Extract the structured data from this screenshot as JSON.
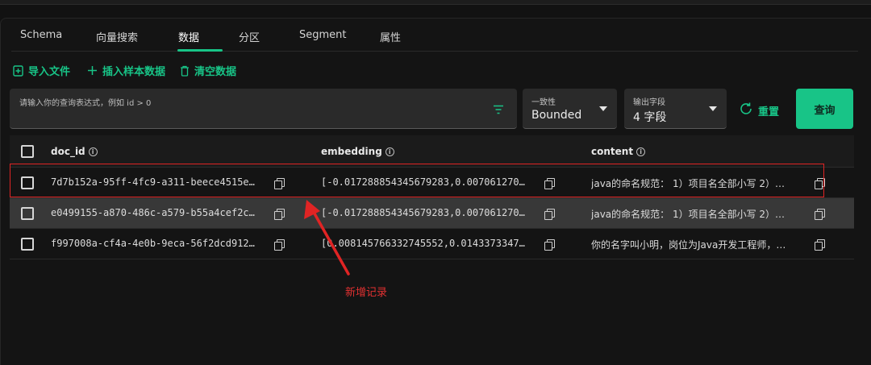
{
  "tabs": [
    {
      "label": "Schema"
    },
    {
      "label": "向量搜索"
    },
    {
      "label": "数据",
      "active": true
    },
    {
      "label": "分区"
    },
    {
      "label": "Segment"
    },
    {
      "label": "属性"
    }
  ],
  "actions": {
    "import": "导入文件",
    "insert_sample": "插入样本数据",
    "clear": "清空数据"
  },
  "query": {
    "placeholder": "请输入你的查询表达式，例如 id > 0"
  },
  "consistency": {
    "label": "一致性",
    "value": "Bounded"
  },
  "output_fields": {
    "label": "输出字段",
    "value": "4 字段"
  },
  "buttons": {
    "reset": "重置",
    "query": "查询"
  },
  "table": {
    "columns": [
      "doc_id",
      "embedding",
      "content"
    ],
    "rows": [
      {
        "doc_id": "7d7b152a-95ff-4fc9-a311-beece4515e…",
        "embedding": "[-0.017288854345679283,0.007061270…",
        "content": "java的命名规范： 1）项目名全部小写 2）…"
      },
      {
        "doc_id": "e0499155-a870-486c-a579-b55a4cef2c…",
        "embedding": "[-0.017288854345679283,0.007061270…",
        "content": "java的命名规范： 1）项目名全部小写 2）…"
      },
      {
        "doc_id": "f997008a-cf4a-4e0b-9eca-56f2dcd912…",
        "embedding": "[0.008145766332745552,0.0143373347…",
        "content": "你的名字叫小明，岗位为Java开发工程师，…"
      }
    ]
  },
  "annotation": {
    "text": "新增记录"
  },
  "colors": {
    "accent": "#18c487",
    "annotation": "#e02424"
  }
}
